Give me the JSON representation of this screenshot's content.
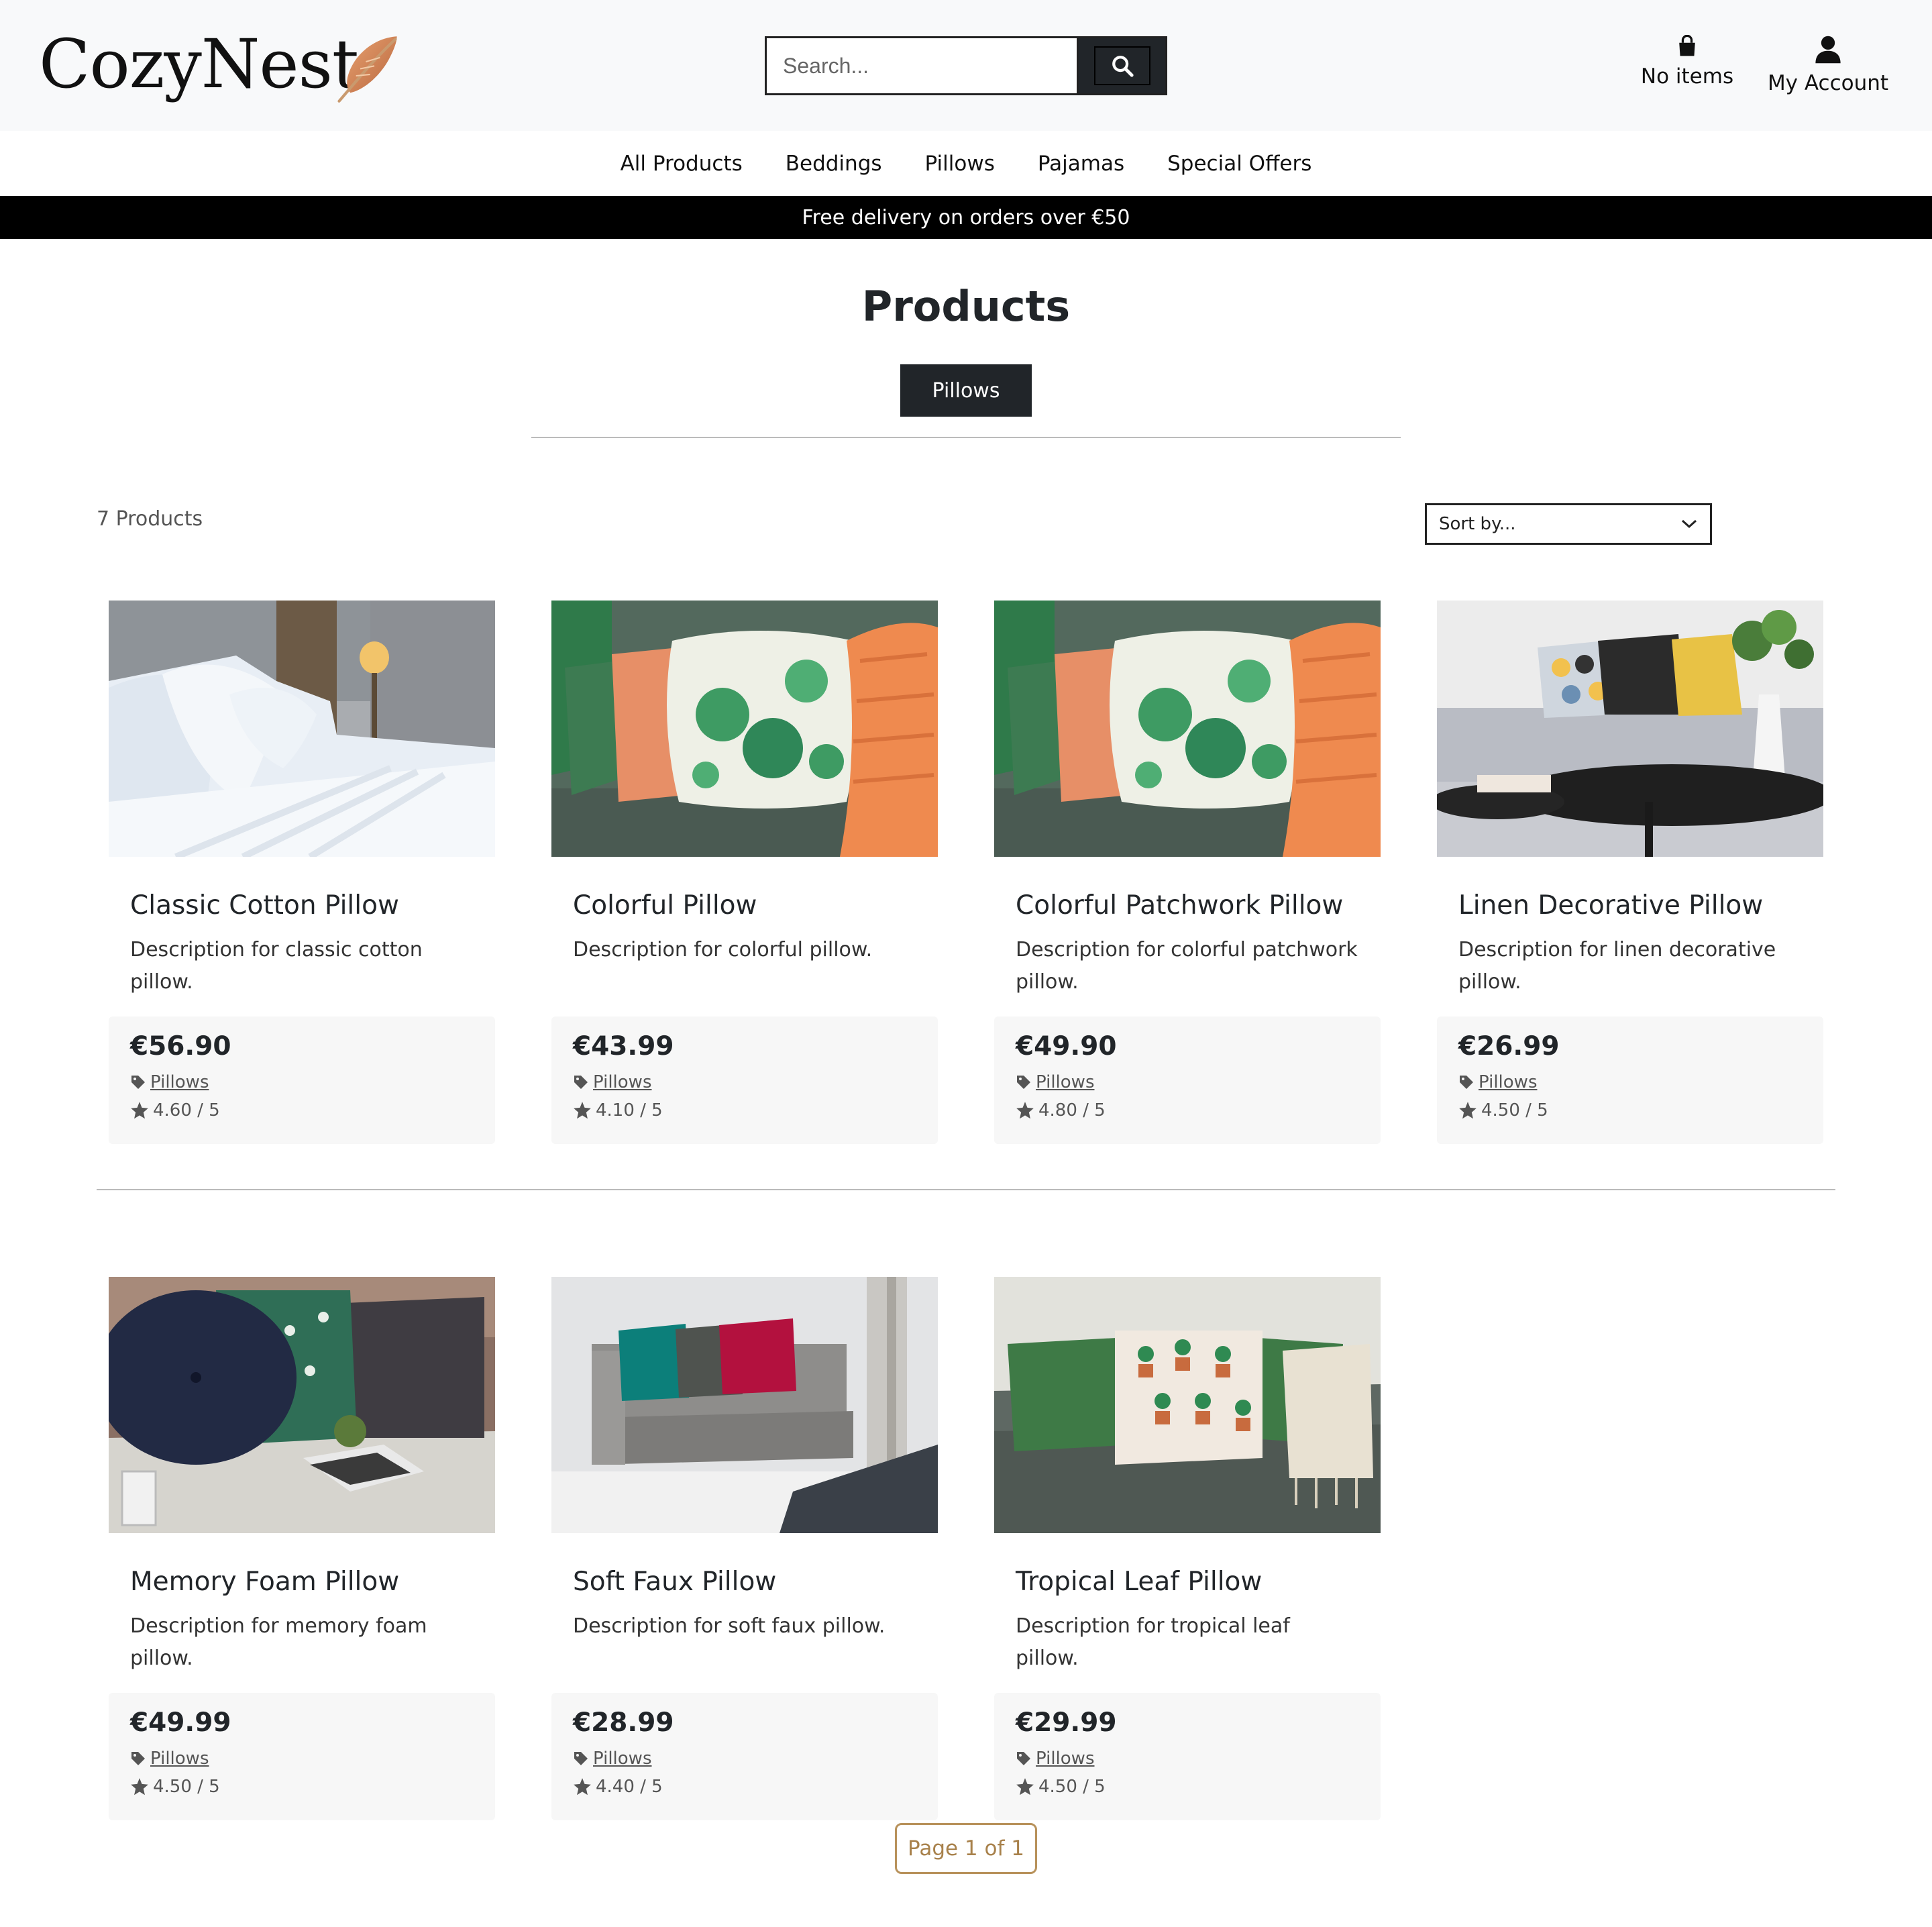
{
  "header": {
    "logo_text": "CozyNest",
    "search_placeholder": "Search...",
    "cart_label": "No items",
    "account_label": "My Account"
  },
  "nav": {
    "items": [
      "All Products",
      "Beddings",
      "Pillows",
      "Pajamas",
      "Special Offers"
    ]
  },
  "banner": {
    "text": "Free delivery on orders over €50"
  },
  "main": {
    "title": "Products",
    "category_badge": "Pillows",
    "product_count": "7 Products",
    "sort_label": "Sort by..."
  },
  "products": [
    {
      "name": "Classic Cotton Pillow",
      "description": "Description for classic cotton pillow.",
      "price": "€56.90",
      "category": "Pillows",
      "rating": "4.60 / 5"
    },
    {
      "name": "Colorful Pillow",
      "description": "Description for colorful pillow.",
      "price": "€43.99",
      "category": "Pillows",
      "rating": "4.10 / 5"
    },
    {
      "name": "Colorful Patchwork Pillow",
      "description": "Description for colorful patchwork pillow.",
      "price": "€49.90",
      "category": "Pillows",
      "rating": "4.80 / 5"
    },
    {
      "name": "Linen Decorative Pillow",
      "description": "Description for linen decorative pillow.",
      "price": "€26.99",
      "category": "Pillows",
      "rating": "4.50 / 5"
    },
    {
      "name": "Memory Foam Pillow",
      "description": "Description for memory foam pillow.",
      "price": "€49.99",
      "category": "Pillows",
      "rating": "4.50 / 5"
    },
    {
      "name": "Soft Faux Pillow",
      "description": "Description for soft faux pillow.",
      "price": "€28.99",
      "category": "Pillows",
      "rating": "4.40 / 5"
    },
    {
      "name": "Tropical Leaf Pillow",
      "description": "Description for tropical leaf pillow.",
      "price": "€29.99",
      "category": "Pillows",
      "rating": "4.50 / 5"
    }
  ],
  "pagination": {
    "label": "Page 1 of 1"
  },
  "icons": {
    "search": "search-icon",
    "cart": "shopping-bag-icon",
    "account": "user-icon",
    "tag": "tag-icon",
    "rating": "star-icon",
    "sort": "chevron-down-icon",
    "logo": "feather-icon"
  },
  "colors": {
    "header_bg": "#f8f9fa",
    "dark": "#212529",
    "banner_bg": "#000000",
    "pager_accent": "#b8925b",
    "card_footer_bg": "#f7f7f7"
  }
}
